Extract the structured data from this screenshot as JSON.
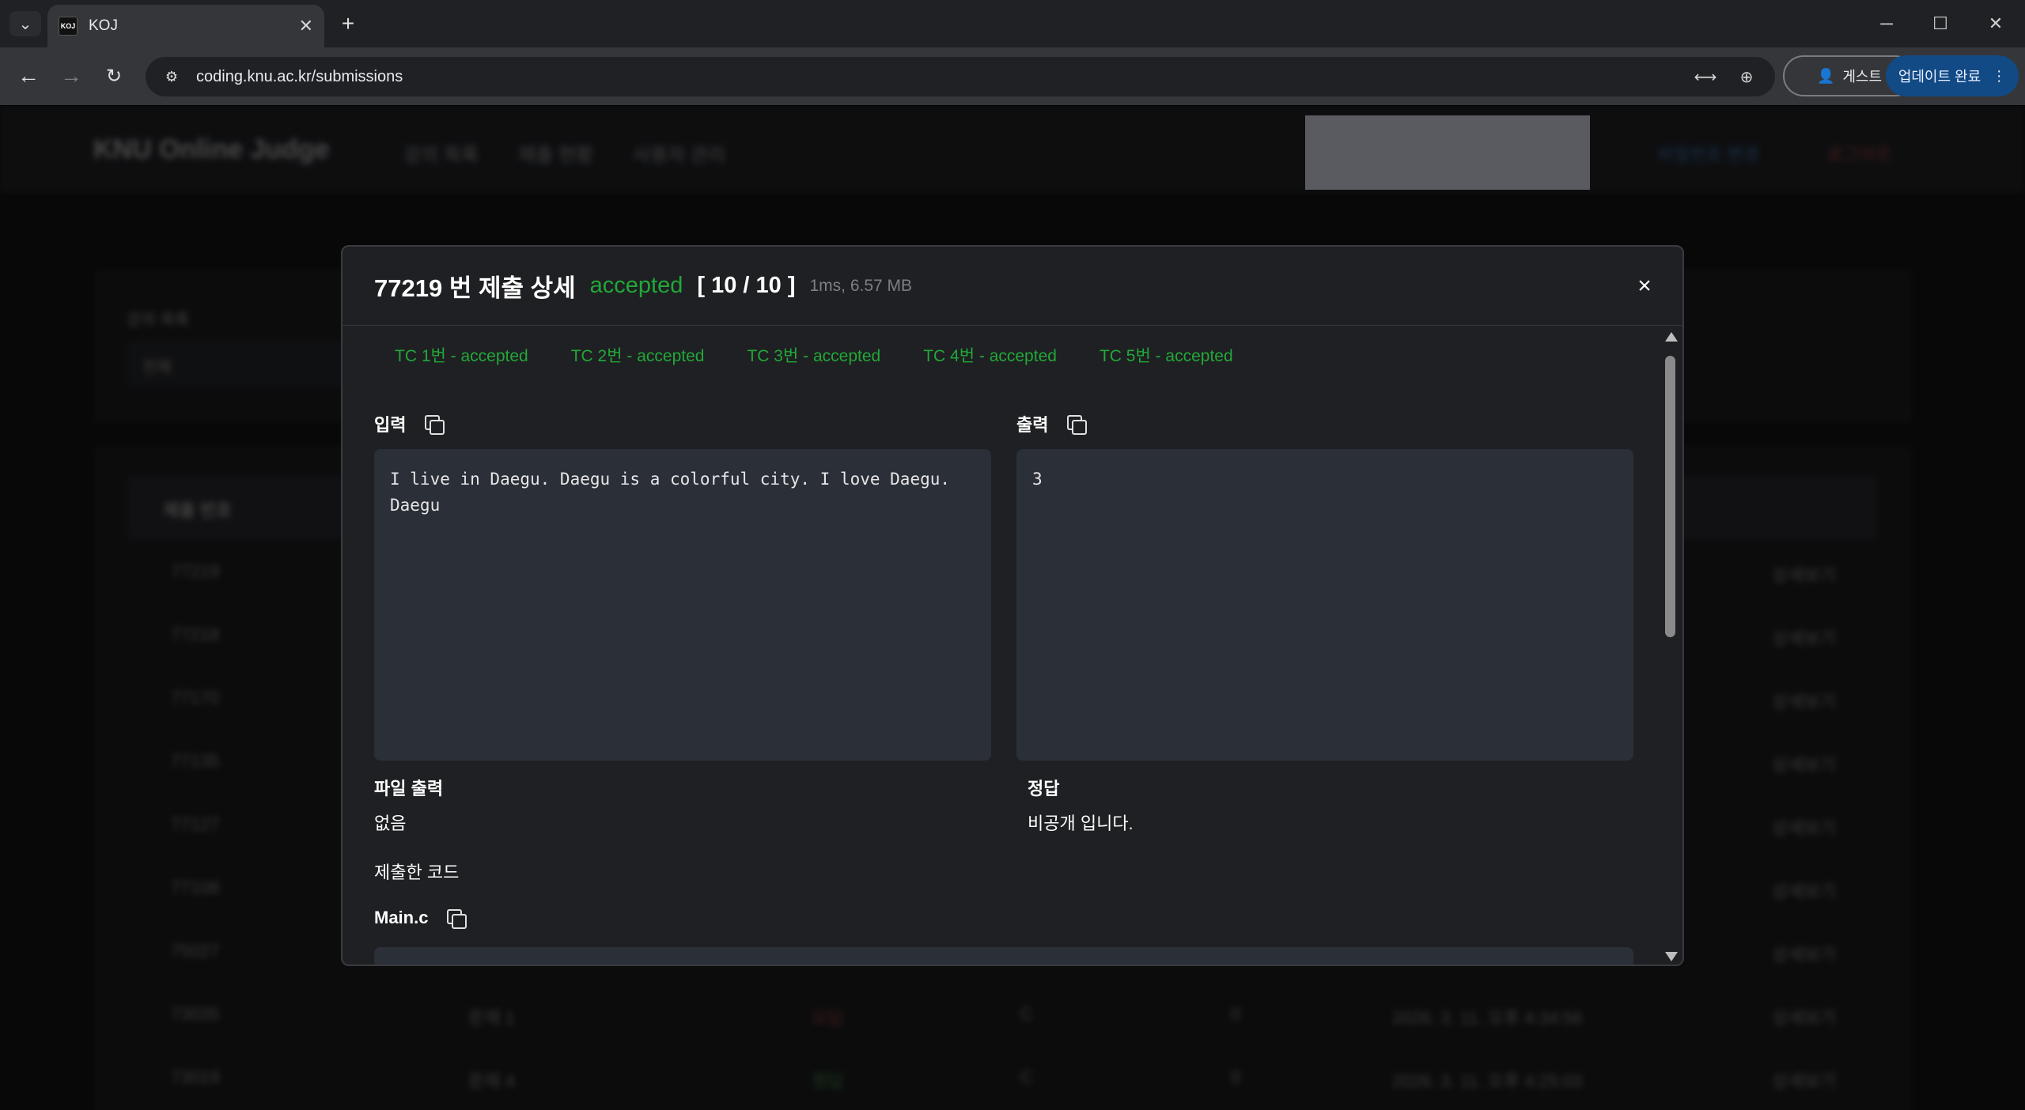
{
  "browser": {
    "tab_title": "KOJ",
    "favicon_text": "KOJ",
    "url": "coding.knu.ac.kr/submissions",
    "guest_label": "게스트",
    "update_label": "업데이트 완료"
  },
  "site": {
    "brand": "KNU Online Judge",
    "nav": [
      "강의 목록",
      "제출 현황",
      "사용자 관리"
    ],
    "link_blue": "비밀번호 변경",
    "link_red": "로그아웃",
    "filter_label": "강의 목록",
    "filter_value": "전체",
    "table_header": "제출 번호",
    "rows": [
      {
        "id": "77219",
        "detail": "상세보기"
      },
      {
        "id": "77218",
        "detail": "상세보기"
      },
      {
        "id": "77170",
        "detail": "상세보기"
      },
      {
        "id": "77135",
        "detail": "상세보기"
      },
      {
        "id": "77127",
        "detail": "상세보기"
      },
      {
        "id": "77108",
        "detail": "상세보기"
      },
      {
        "id": "75027",
        "detail": "상세보기"
      },
      {
        "id": "73035",
        "problem": "문제 1",
        "result": "오답",
        "lang": "C",
        "score": "0",
        "date": "2026. 3. 11. 오후 4:34:56",
        "detail": "상세보기"
      },
      {
        "id": "73019",
        "problem": "문제 4",
        "result": "정답",
        "lang": "C",
        "score": "0",
        "date": "2026. 3. 11. 오후 4:25:03",
        "detail": "상세보기"
      }
    ]
  },
  "modal": {
    "title": "77219 번 제출 상세",
    "status": "accepted",
    "score": "[ 10 / 10 ]",
    "meta": "1ms, 6.57 MB",
    "close_label": "×",
    "tabs": [
      "TC 1번 - accepted",
      "TC 2번 - accepted",
      "TC 3번 - accepted",
      "TC 4번 - accepted",
      "TC 5번 - accepted"
    ],
    "input_label": "입력",
    "input_value": "I live in Daegu. Daegu is a colorful city. I love Daegu.\nDaegu",
    "output_label": "출력",
    "output_value": "3",
    "file_output_label": "파일 출력",
    "file_output_value": "없음",
    "answer_label": "정답",
    "answer_value": "비공개 입니다.",
    "submitted_code_label": "제출한 코드",
    "file_name": "Main.c"
  },
  "colors": {
    "accepted": "#22a838",
    "modal_bg": "#1f2023",
    "code_bg": "#2b2f38"
  }
}
